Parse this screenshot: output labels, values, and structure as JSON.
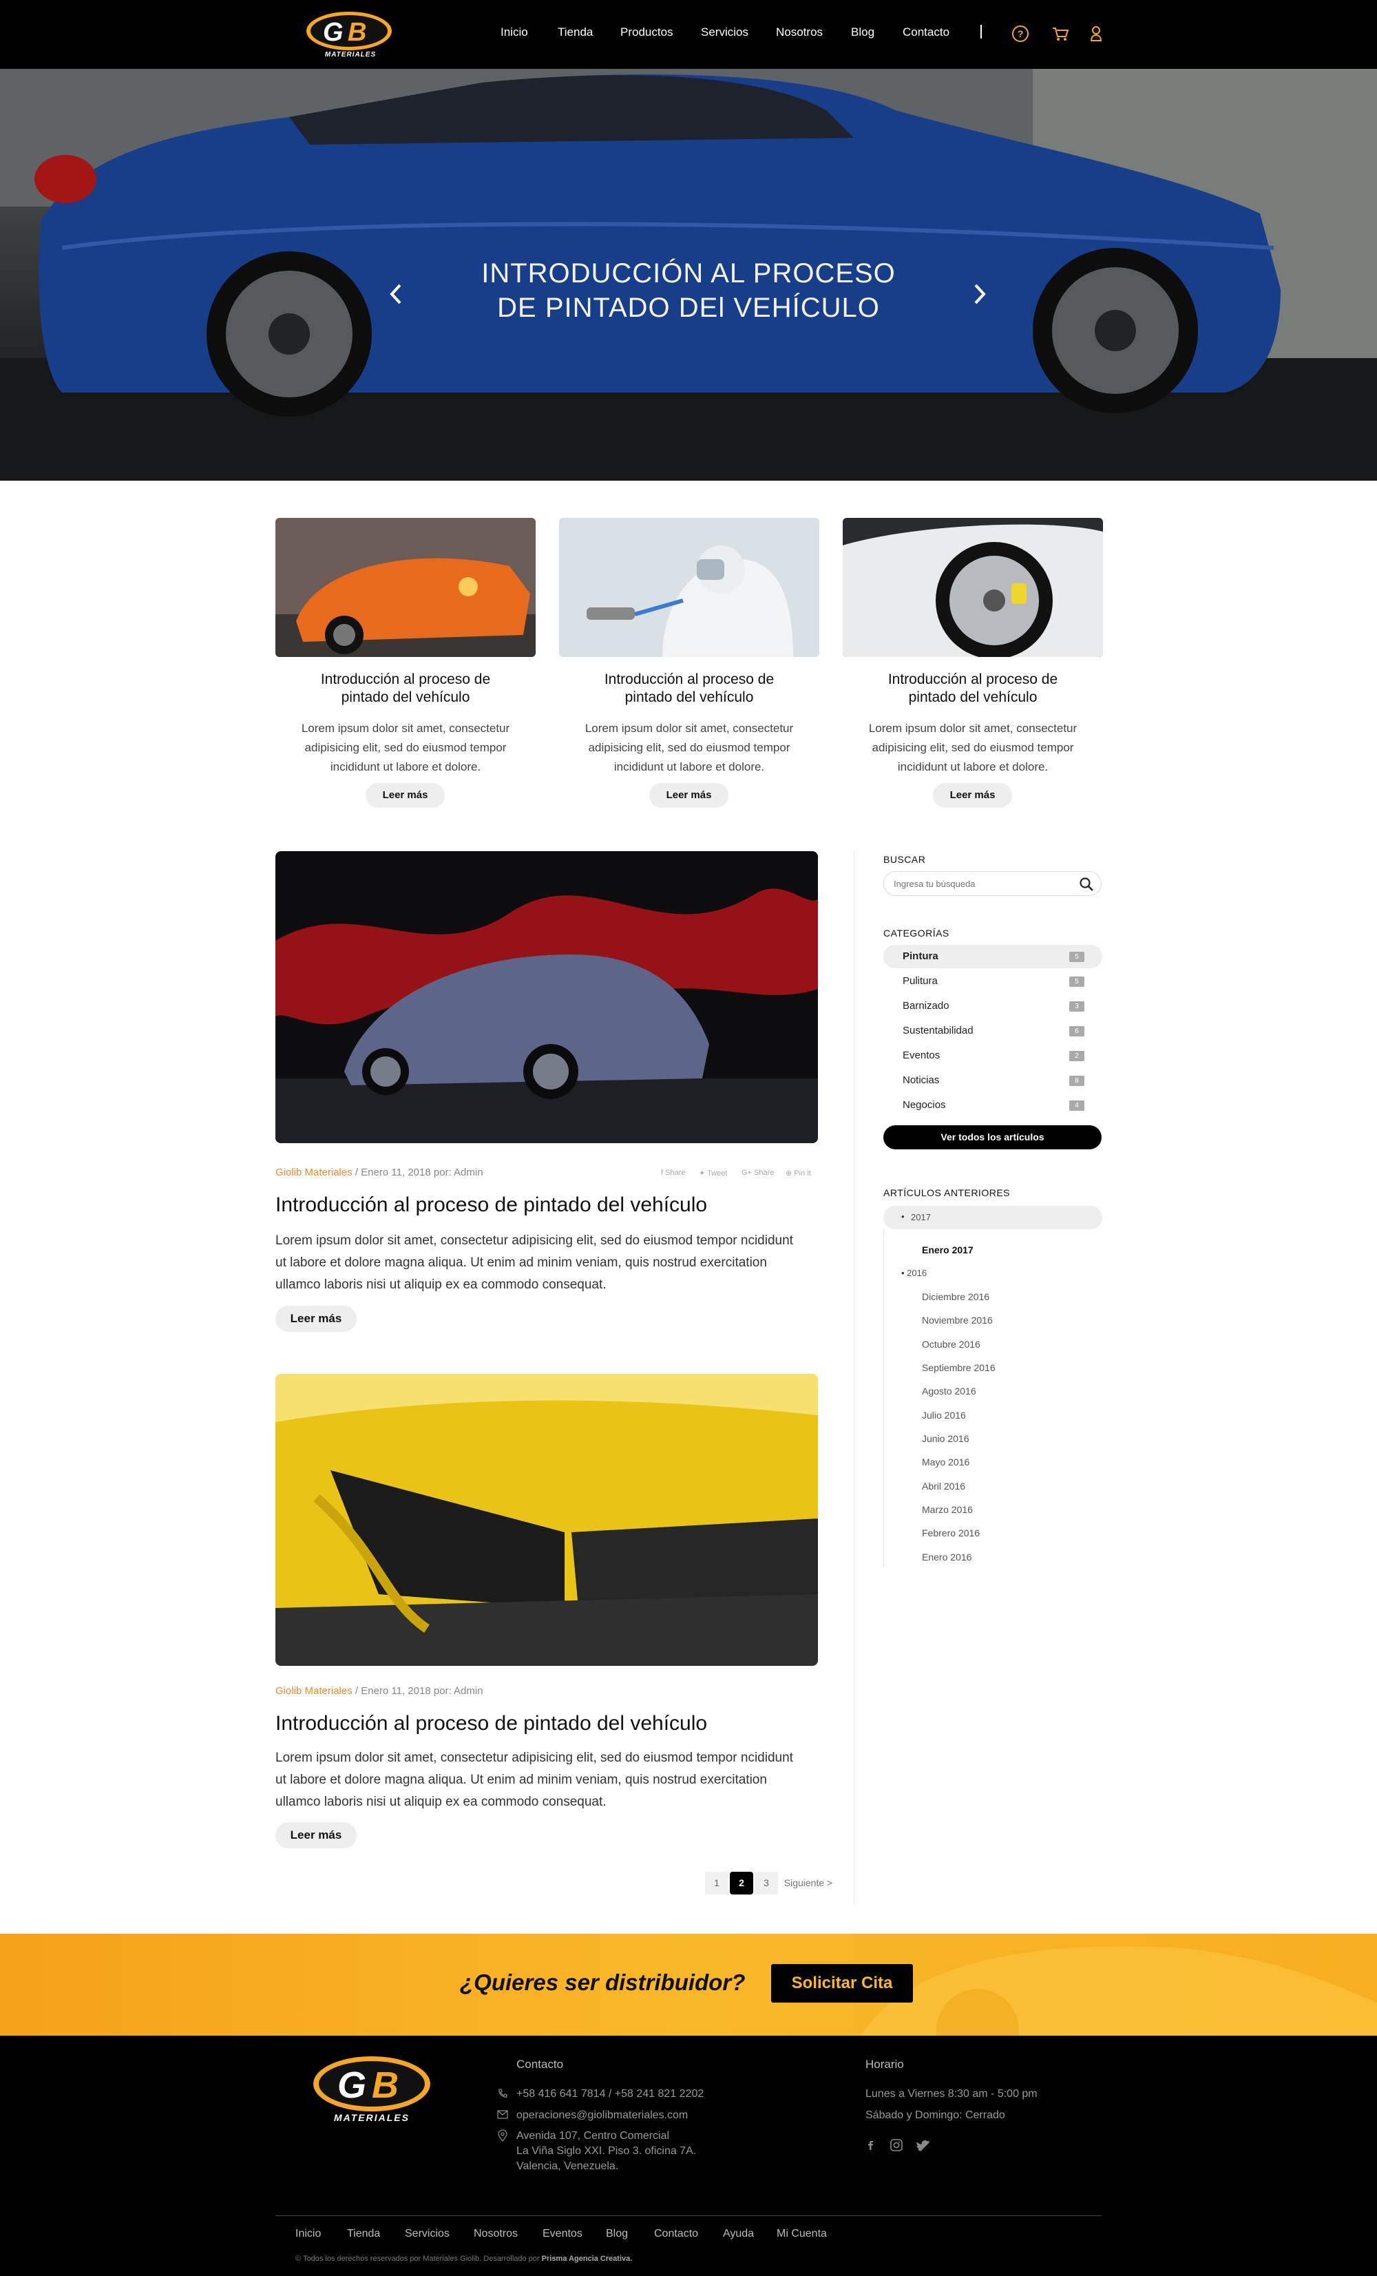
{
  "nav": {
    "logo_text": "GB",
    "logo_sub": "MATERIALES",
    "links": [
      "Inicio",
      "Tienda",
      "Productos",
      "Servicios",
      "Nosotros",
      "Blog",
      "Contacto"
    ],
    "sep": "|"
  },
  "hero": {
    "title_line1": "INTRODUCCIÓN AL PROCESO",
    "title_line2": "DE PINTADO DEl VEHÍCULO"
  },
  "cards": [
    {
      "title_l1": "Introducción al proceso de",
      "title_l2": "pintado del vehículo",
      "text_l1": "Lorem ipsum dolor sit amet, consectetur",
      "text_l2": "adipisicing elit, sed do eiusmod tempor",
      "text_l3": "incididunt ut labore et dolore.",
      "button": "Leer más"
    },
    {
      "title_l1": "Introducción al proceso de",
      "title_l2": "pintado del vehículo",
      "text_l1": "Lorem ipsum dolor sit amet, consectetur",
      "text_l2": "adipisicing elit, sed do eiusmod tempor",
      "text_l3": "incididunt ut labore et dolore.",
      "button": "Leer más"
    },
    {
      "title_l1": "Introducción al proceso de",
      "title_l2": "pintado del vehículo",
      "text_l1": "Lorem ipsum dolor sit amet, consectetur",
      "text_l2": "adipisicing elit, sed do eiusmod tempor",
      "text_l3": "incididunt ut labore et dolore.",
      "button": "Leer más"
    }
  ],
  "posts": [
    {
      "brand": "Giolib Materiales",
      "meta": " / Enero 11, 2018 por: Admin",
      "title": "Introducción al proceso de pintado del vehículo",
      "text_l1": "Lorem ipsum dolor sit amet, consectetur adipisicing elit, sed do eiusmod tempor ncididunt",
      "text_l2": "ut labore et dolore magna aliqua. Ut enim ad minim veniam, quis nostrud exercitation",
      "text_l3": "ullamco laboris nisi ut aliquip ex ea commodo consequat.",
      "button": "Leer más"
    },
    {
      "brand": "Giolib Materiales",
      "meta": " / Enero 11, 2018 por: Admin",
      "title": "Introducción al proceso de pintado del vehículo",
      "text_l1": "Lorem ipsum dolor sit amet, consectetur adipisicing elit, sed do eiusmod tempor ncididunt",
      "text_l2": "ut labore et dolore magna aliqua. Ut enim ad minim veniam, quis nostrud exercitation",
      "text_l3": "ullamco laboris nisi ut aliquip ex ea commodo consequat.",
      "button": "Leer más"
    }
  ],
  "share": [
    "Share",
    "Tweet",
    "Share",
    "Pin it"
  ],
  "sidebar": {
    "search_head": "BUSCAR",
    "search_placeholder": "Ingresa tu búsqueda",
    "cat_head": "CATEGORÍAS",
    "categories": [
      {
        "label": "Pintura",
        "count": "5"
      },
      {
        "label": "Pulitura",
        "count": "5"
      },
      {
        "label": "Barnizado",
        "count": "3"
      },
      {
        "label": "Sustentabilidad",
        "count": "6"
      },
      {
        "label": "Eventos",
        "count": "2"
      },
      {
        "label": "Noticias",
        "count": "8"
      },
      {
        "label": "Negocios",
        "count": "4"
      }
    ],
    "all_button": "Ver todos los artículos",
    "archive_head": "ARTÍCULOS ANTERIORES",
    "year_2017": "2017",
    "jan_2017": "Enero 2017",
    "year_2016": "2016",
    "months_2016": [
      "Diciembre 2016",
      "Noviembre 2016",
      "Octubre 2016",
      "Septiembre 2016",
      "Agosto 2016",
      "Julio 2016",
      "Junio 2016",
      "Mayo 2016",
      "Abril 2016",
      "Marzo 2016",
      "Febrero 2016",
      "Enero 2016"
    ]
  },
  "pagination": {
    "p1": "1",
    "p2": "2",
    "p3": "3",
    "next": "Siguiente >"
  },
  "cta": {
    "text": "¿Quieres ser distribuidor?",
    "button": "Solicitar Cita"
  },
  "footer": {
    "contact_head": "Contacto",
    "phone": "+58 416 641 7814 / +58 241 821 2202",
    "email": "operaciones@giolibmateriales.com",
    "addr_l1": "Avenida 107, Centro Comercial",
    "addr_l2": "La Viña Siglo XXI. Piso 3. oficina 7A.",
    "addr_l3": "Valencia, Venezuela.",
    "hours_head": "Horario",
    "hours_l1": "Lunes a Viernes 8:30 am - 5:00 pm",
    "hours_l2": "Sábado y Domingo: Cerrado",
    "links": [
      "Inicio",
      "Tienda",
      "Servicios",
      "Nosotros",
      "Eventos",
      "Blog",
      "Contacto",
      "Ayuda",
      "Mi Cuenta"
    ],
    "copyright": "© Todos los derechos reservados por Materiales Giolib. Desarrollado por ",
    "copyright_brand": "Prisma Agencia Creativa."
  },
  "colors": {
    "accent": "#f08a24",
    "cta_yellow": "#f9b828",
    "dark": "#000000"
  }
}
